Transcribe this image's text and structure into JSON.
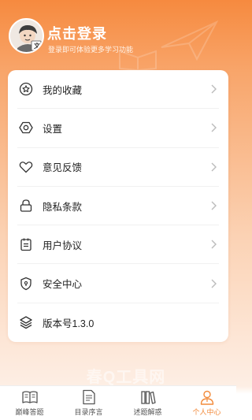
{
  "header": {
    "title": "点击登录",
    "subtitle": "登录即可体验更多学习功能",
    "avatar_badge": "文"
  },
  "menu": {
    "items": [
      {
        "label": "我的收藏",
        "icon": "star-icon"
      },
      {
        "label": "设置",
        "icon": "settings-icon"
      },
      {
        "label": "意见反馈",
        "icon": "heart-icon"
      },
      {
        "label": "隐私条款",
        "icon": "lock-icon"
      },
      {
        "label": "用户协议",
        "icon": "clipboard-icon"
      },
      {
        "label": "安全中心",
        "icon": "shield-icon"
      },
      {
        "label": "版本号1.3.0",
        "icon": "layers-icon"
      }
    ]
  },
  "watermark": "春Q工具网",
  "tabbar": {
    "tabs": [
      {
        "label": "巅峰答题",
        "icon": "book-icon",
        "active": false
      },
      {
        "label": "目录序言",
        "icon": "document-icon",
        "active": false
      },
      {
        "label": "述题解惑",
        "icon": "books-icon",
        "active": false
      },
      {
        "label": "个人中心",
        "icon": "person-icon",
        "active": true
      }
    ]
  },
  "colors": {
    "accent": "#f28a3a",
    "header_top": "#f68a3f",
    "text": "#222222",
    "chevron": "#bbbbbb"
  }
}
